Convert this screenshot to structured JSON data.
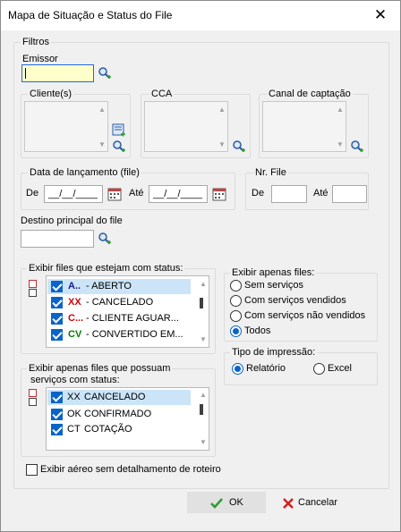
{
  "window": {
    "title": "Mapa de Situação e Status do File"
  },
  "filters": {
    "group_label": "Filtros",
    "emissor": {
      "label": "Emissor",
      "value": ""
    },
    "cliente": {
      "label": "Cliente(s)"
    },
    "cca": {
      "label": "CCA"
    },
    "canal": {
      "label": "Canal de captação"
    },
    "data_lancamento": {
      "label": "Data de lançamento (file)",
      "de_label": "De",
      "de_value": "__/__/____",
      "ate_label": "Até",
      "ate_value": "__/__/____"
    },
    "nr_file": {
      "label": "Nr. File",
      "de_label": "De",
      "ate_label": "Até"
    },
    "destino": {
      "label": "Destino principal do file",
      "value": ""
    }
  },
  "status_files": {
    "label": "Exibir files que estejam com status:",
    "items": [
      {
        "code": "A..",
        "text": "- ABERTO",
        "code_color": "#1a1a8c",
        "checked": true
      },
      {
        "code": "XX",
        "text": "- CANCELADO",
        "code_color": "#d00000",
        "checked": true
      },
      {
        "code": "C...",
        "text": "- CLIENTE AGUAR...",
        "code_color": "#d00000",
        "checked": true
      },
      {
        "code": "CV",
        "text": "- CONVERTIDO EM...",
        "code_color": "#008000",
        "checked": true
      }
    ]
  },
  "exibir_apenas": {
    "label": "Exibir apenas files:",
    "options": [
      {
        "label": "Sem serviços",
        "selected": false
      },
      {
        "label": "Com serviços vendidos",
        "selected": false
      },
      {
        "label": "Com serviços não vendidos",
        "selected": false
      },
      {
        "label": "Todos",
        "selected": true
      }
    ]
  },
  "tipo_impressao": {
    "label": "Tipo de impressão:",
    "options": [
      {
        "label": "Relatório",
        "selected": true
      },
      {
        "label": "Excel",
        "selected": false
      }
    ]
  },
  "servicos_status": {
    "label_line1": "Exibir apenas files que possuam",
    "label_line2": "serviços com status:",
    "items": [
      {
        "code": "XX",
        "text": "CANCELADO",
        "checked": true
      },
      {
        "code": "OK",
        "text": "CONFIRMADO",
        "checked": true
      },
      {
        "code": "CT",
        "text": "COTAÇÃO",
        "checked": true
      }
    ]
  },
  "aereo": {
    "label": "Exibir aéreo sem detalhamento de roteiro",
    "checked": false
  },
  "buttons": {
    "ok": "OK",
    "cancel": "Cancelar"
  },
  "colors": {
    "accent": "#0a64c8",
    "ok_check": "#2e9e2e",
    "cancel_x": "#d02020"
  },
  "icons": [
    "search-icon",
    "calendar-icon",
    "close-icon",
    "checkmark-icon",
    "cross-icon",
    "select-all-icon",
    "deselect-all-icon",
    "list-icon"
  ]
}
